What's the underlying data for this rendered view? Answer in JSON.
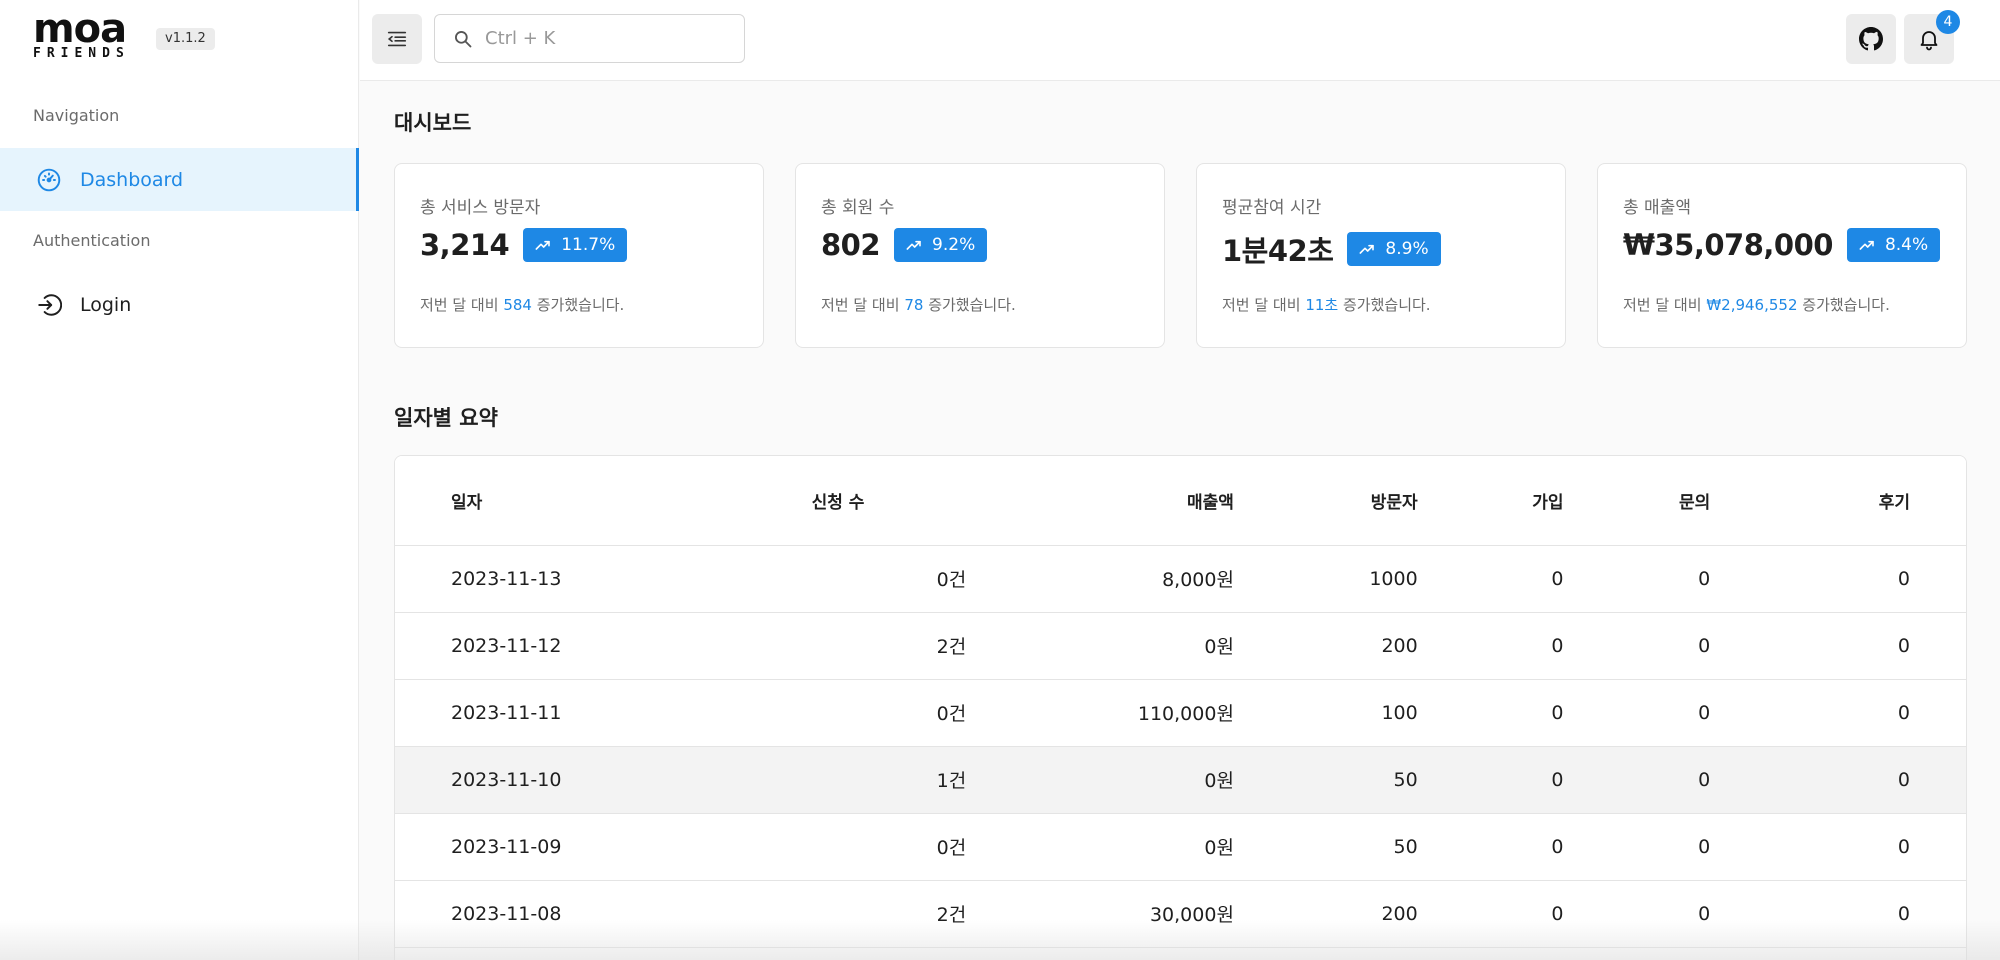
{
  "app": {
    "logo_text": "moa",
    "logo_sub": "FRIENDS",
    "version": "v1.1.2"
  },
  "sidebar": {
    "sections": [
      {
        "label": "Navigation",
        "items": [
          {
            "label": "Dashboard",
            "icon": "dashboard-icon",
            "active": true
          }
        ]
      },
      {
        "label": "Authentication",
        "items": [
          {
            "label": "Login",
            "icon": "login-icon",
            "active": false
          }
        ]
      }
    ]
  },
  "topbar": {
    "search_placeholder": "Ctrl + K",
    "search_value": "",
    "notification_count": "4"
  },
  "dashboard": {
    "title": "대시보드",
    "cards": [
      {
        "label": "총 서비스 방문자",
        "value": "3,214",
        "change": "11.7%",
        "note_prefix": "저번 달 대비",
        "note_value": "584",
        "note_suffix": "증가했습니다."
      },
      {
        "label": "총 회원 수",
        "value": "802",
        "change": "9.2%",
        "note_prefix": "저번 달 대비",
        "note_value": "78",
        "note_suffix": "증가했습니다."
      },
      {
        "label": "평균참여 시간",
        "value": "1분42초",
        "change": "8.9%",
        "note_prefix": "저번 달 대비",
        "note_value": "11초",
        "note_suffix": "증가했습니다."
      },
      {
        "label": "총 매출액",
        "value": "₩35,078,000",
        "change": "8.4%",
        "note_prefix": "저번 달 대비",
        "note_value": "₩2,946,552",
        "note_suffix": "증가했습니다."
      }
    ]
  },
  "daily": {
    "title": "일자별 요약",
    "columns": [
      "일자",
      "신청 수",
      "매출액",
      "방문자",
      "가입",
      "문의",
      "후기"
    ],
    "rows": [
      [
        "2023-11-13",
        "0건",
        "8,000원",
        "1000",
        "0",
        "0",
        "0"
      ],
      [
        "2023-11-12",
        "2건",
        "0원",
        "200",
        "0",
        "0",
        "0"
      ],
      [
        "2023-11-11",
        "0건",
        "110,000원",
        "100",
        "0",
        "0",
        "0"
      ],
      [
        "2023-11-10",
        "1건",
        "0원",
        "50",
        "0",
        "0",
        "0"
      ],
      [
        "2023-11-09",
        "0건",
        "0원",
        "50",
        "0",
        "0",
        "0"
      ],
      [
        "2023-11-08",
        "2건",
        "30,000원",
        "200",
        "0",
        "0",
        "0"
      ]
    ]
  },
  "colors": {
    "accent": "#1e88e5",
    "active_bg": "#e6f4fd"
  }
}
